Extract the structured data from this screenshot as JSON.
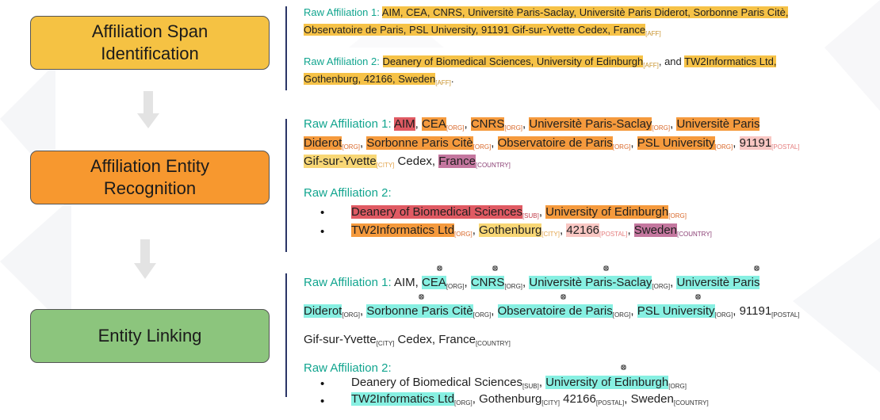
{
  "colors": {
    "stage1": "#f5c243",
    "stage2": "#f7982f",
    "stage3": "#8cc57d",
    "teal_label": "#12a58f",
    "divider": "#2a3566",
    "arrow": "#e3e3e3"
  },
  "stages": [
    {
      "label": "Affiliation Span Identification"
    },
    {
      "label": "Affiliation Entity Recognition"
    },
    {
      "label": "Entity Linking"
    }
  ],
  "span": {
    "aff1_label": "Raw Affiliation 1:",
    "aff1_text_a": "AIM, CEA, CNRS, Universitè Paris-Saclay, Universitè Paris Diderot, Sorbonne Paris Citè,",
    "aff1_text_b": "Observatoire de Paris, PSL University, 91191 Gif-sur-Yvette Cedex, France",
    "aff1_tag": "[AFF]",
    "aff2_label": "Raw Affiliation 2:",
    "aff2_span1": "Deanery of Biomedical Sciences, University of Edinburgh",
    "aff2_tag1": "[AFF]",
    "aff2_mid": ", and ",
    "aff2_span2a": "TW2Informatics Ltd,",
    "aff2_span2b": "Gothenburg, 42166, Sweden",
    "aff2_tag2": "[AFF]",
    "aff2_end": "."
  },
  "ner": {
    "aff1_label": "Raw Affiliation 1:",
    "aff2_label": "Raw Affiliation 2:",
    "aim": "AIM",
    "cea": "CEA",
    "cnrs": "CNRS",
    "ups": "Universitè Paris-Saclay",
    "up_a": "Universitè Paris",
    "up_b": "Diderot",
    "spc": "Sorbonne Paris Citè",
    "obs": "Observatoire de Paris",
    "psl": "PSL University",
    "postal1": "91191",
    "city1": "Gif-sur-Yvette",
    "cedex": "Cedex,",
    "country1": "France",
    "dbs": "Deanery of Biomedical Sciences",
    "uoe": "University of Edinburgh",
    "tw2": "TW2Informatics Ltd",
    "city2": "Gothenburg",
    "postal2": "42166",
    "country2": "Sweden",
    "t_org": "[ORG]",
    "t_postal": "[POSTAL]",
    "t_city": "[CITY]",
    "t_country": "[COUNTRY]",
    "t_sub": "[SUB]",
    "comma": ","
  },
  "link": {
    "aff1_label": "Raw Affiliation 1:",
    "aff2_label": "Raw Affiliation 2:",
    "aim": "AIM",
    "cea": "CEA",
    "cnrs": "CNRS",
    "ups": "Universitè Paris-Saclay",
    "up_a": "Universitè Paris",
    "up_b": "Diderot",
    "spc": "Sorbonne Paris Citè",
    "obs": "Observatoire de Paris",
    "psl": "PSL University",
    "postal1": "91191",
    "city1": "Gif-sur-Yvette",
    "cedex": "Cedex,",
    "country1": "France",
    "dbs": "Deanery of Biomedical Sciences",
    "uoe": "University of Edinburgh",
    "tw2": "TW2Informatics Ltd",
    "city2": "Gothenburg",
    "postal2": "42166",
    "country2": "Sweden",
    "t_org": "[ORG]",
    "t_postal": "[POSTAL]",
    "t_city": "[CITY]",
    "t_cityp": "[CITY]",
    "t_country": "[COUNTRY]",
    "t_sub": "[SUB]",
    "comma": ","
  },
  "bullet_char": "•",
  "link_icon": "ror-link-icon"
}
